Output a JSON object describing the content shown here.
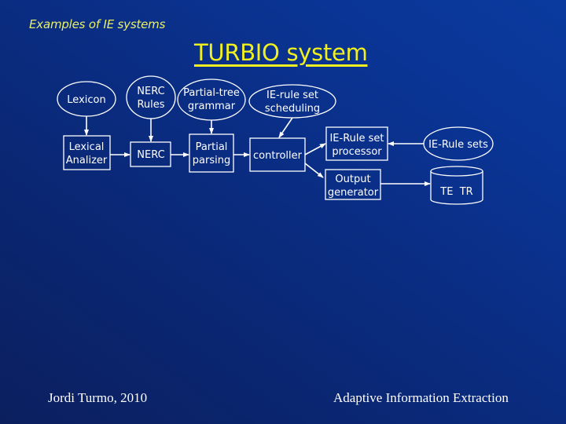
{
  "slide": {
    "subtitle": "Examples of IE systems",
    "title": "TURBIO system",
    "footer_left": "Jordi Turmo, 2010",
    "footer_right": "Adaptive Information Extraction",
    "colors": {
      "subtitle": "#e8f06a",
      "title": "#f0f020",
      "shapes": "#ffffff",
      "background_dark": "#0b1f5e",
      "background_light": "#0a3a9e"
    }
  },
  "diagram": {
    "resources": [
      {
        "id": "lexicon",
        "shape": "ellipse",
        "lines": [
          "Lexicon"
        ]
      },
      {
        "id": "nerc-rules",
        "shape": "ellipse",
        "lines": [
          "NERC",
          "Rules"
        ]
      },
      {
        "id": "partial-tree-grammar",
        "shape": "ellipse",
        "lines": [
          "Partial-tree",
          "grammar"
        ]
      },
      {
        "id": "ie-rule-set-scheduling",
        "shape": "ellipse",
        "lines": [
          "IE-rule set",
          "scheduling"
        ]
      },
      {
        "id": "ie-rule-sets",
        "shape": "ellipse",
        "lines": [
          "IE-Rule sets"
        ]
      },
      {
        "id": "te-tr",
        "shape": "cylinder",
        "lines": [
          "TE  TR"
        ]
      }
    ],
    "modules": [
      {
        "id": "lexical-analizer",
        "shape": "box",
        "lines": [
          "Lexical",
          "Analizer"
        ]
      },
      {
        "id": "nerc",
        "shape": "box",
        "lines": [
          "NERC"
        ]
      },
      {
        "id": "partial-parsing",
        "shape": "box",
        "lines": [
          "Partial",
          "parsing"
        ]
      },
      {
        "id": "controller",
        "shape": "box",
        "lines": [
          "controller"
        ]
      },
      {
        "id": "ie-rule-set-processor",
        "shape": "box",
        "lines": [
          "IE-Rule set",
          "processor"
        ]
      },
      {
        "id": "output-generator",
        "shape": "box",
        "lines": [
          "Output",
          "generator"
        ]
      }
    ],
    "edges": [
      {
        "from": "lexicon",
        "to": "lexical-analizer"
      },
      {
        "from": "nerc-rules",
        "to": "nerc"
      },
      {
        "from": "partial-tree-grammar",
        "to": "partial-parsing"
      },
      {
        "from": "ie-rule-set-scheduling",
        "to": "controller"
      },
      {
        "from": "lexical-analizer",
        "to": "nerc"
      },
      {
        "from": "nerc",
        "to": "partial-parsing"
      },
      {
        "from": "partial-parsing",
        "to": "controller"
      },
      {
        "from": "controller",
        "to": "ie-rule-set-processor"
      },
      {
        "from": "controller",
        "to": "output-generator"
      },
      {
        "from": "ie-rule-sets",
        "to": "ie-rule-set-processor"
      },
      {
        "from": "output-generator",
        "to": "te-tr"
      }
    ]
  }
}
